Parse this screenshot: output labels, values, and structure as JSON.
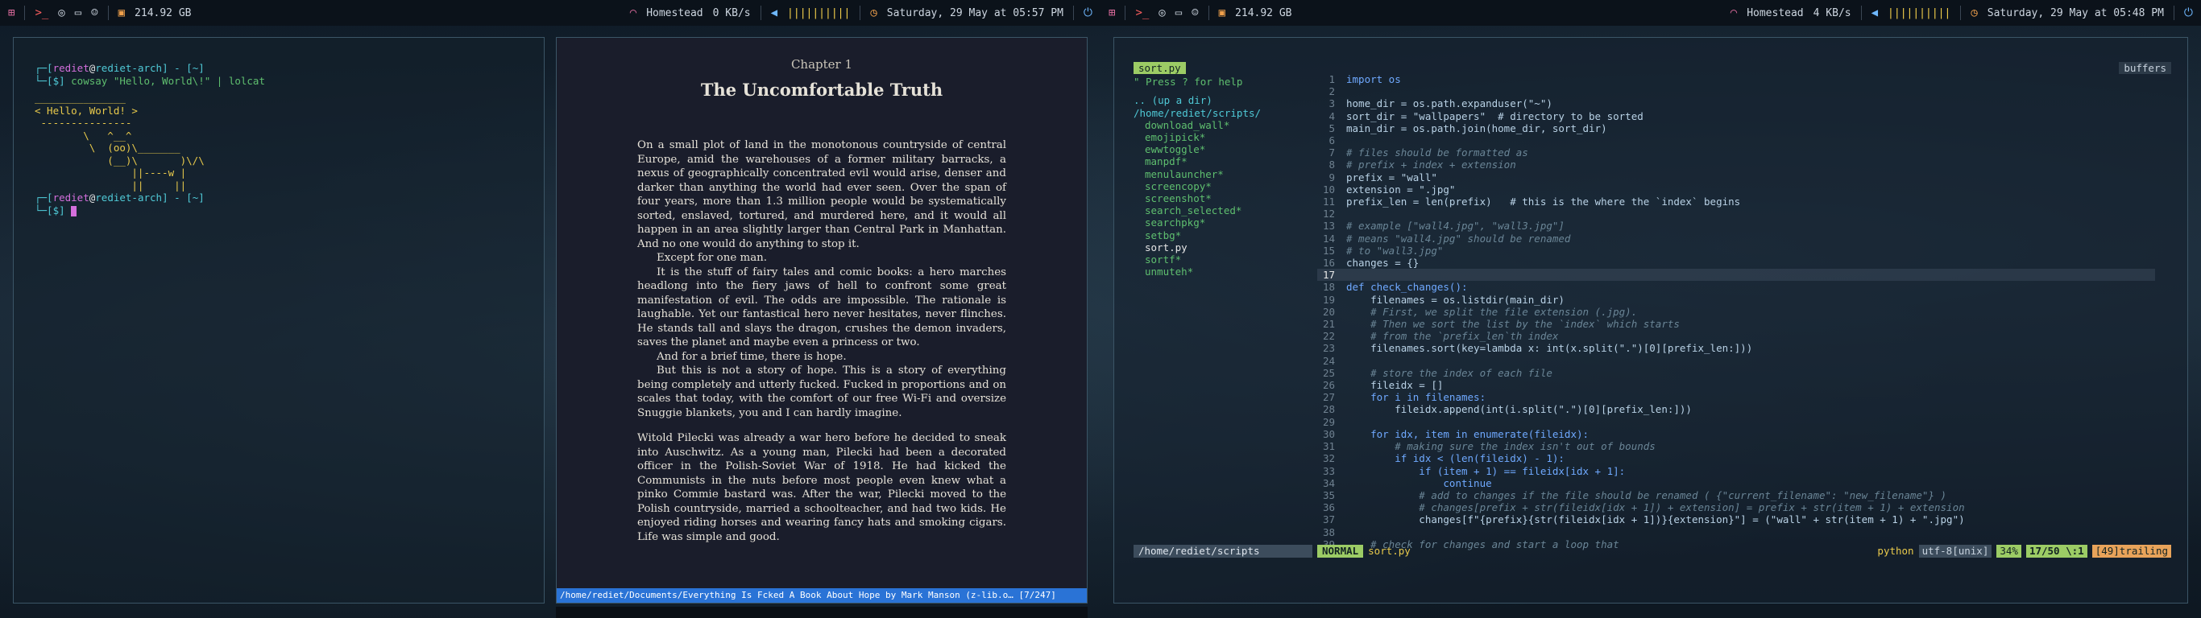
{
  "left_bar": {
    "storage": "214.92 GB",
    "network_name": "Homestead",
    "network_speed": "0 KB/s",
    "volume_bars": "||||||||||",
    "clock": "Saturday, 29 May at 05:57 PM"
  },
  "right_bar": {
    "storage": "214.92 GB",
    "network_name": "Homestead",
    "network_speed": "4 KB/s",
    "volume_bars": "||||||||||",
    "clock": "Saturday, 29 May at 05:48 PM"
  },
  "terminal": {
    "user": "rediet",
    "at": "@",
    "host": "rediet-arch",
    "path": "[~]",
    "command": "cowsay \"Hello, World\\!\" | lolcat",
    "cow_lines": [
      "_______________",
      "< Hello, World! >",
      " ---------------",
      "        \\   ^__^",
      "         \\  (oo)\\_______",
      "            (__)\\       )\\/\\",
      "                ||----w |",
      "                ||     ||"
    ]
  },
  "reader": {
    "chapter": "Chapter 1",
    "title": "The Uncomfortable Truth",
    "paragraphs": [
      "On a small plot of land in the monotonous countryside of central Europe, amid the warehouses of a former military barracks, a nexus of geographically concentrated evil would arise, denser and darker than anything the world had ever seen. Over the span of four years, more than 1.3 million people would be systematically sorted, enslaved, tortured, and murdered here, and it would all happen in an area slightly larger than Central Park in Manhattan. And no one would do anything to stop it.",
      "Except for one man.",
      "It is the stuff of fairy tales and comic books: a hero marches headlong into the fiery jaws of hell to confront some great manifestation of evil. The odds are impossible. The rationale is laughable. Yet our fantastical hero never hesitates, never flinches. He stands tall and slays the dragon, crushes the demon invaders, saves the planet and maybe even a princess or two.",
      "And for a brief time, there is hope.",
      "But this is not a story of hope. This is a story of everything being completely and utterly fucked. Fucked in proportions and on scales that today, with the comfort of our free Wi-Fi and oversize Snuggie blankets, you and I can hardly imagine.",
      "Witold Pilecki was already a war hero before he decided to sneak into Auschwitz. As a young man, Pilecki had been a decorated officer in the Polish-Soviet War of 1918. He had kicked the Communists in the nuts before most people even knew what a pinko Commie bastard was. After the war, Pilecki moved to the Polish countryside, married a schoolteacher, and had two kids. He enjoyed riding horses and wearing fancy hats and smoking cigars. Life was simple and good."
    ],
    "status": "/home/rediet/Documents/Everything Is Fcked A Book About Hope by Mark Manson (z-lib.o… [7/247]"
  },
  "vim": {
    "nerd_tab": "sort.py",
    "help": "\" Press ? for help",
    "buffers": "buffers",
    "up": ".. (up a dir)",
    "cwd": "/home/rediet/scripts/",
    "files": [
      "download_wall*",
      "emojipick*",
      "ewwtoggle*",
      "manpdf*",
      "menulauncher*",
      "screencopy*",
      "screenshot*",
      "search_selected*",
      "searchpkg*",
      "setbg*",
      "sort.py",
      "sortf*",
      "unmuteh*"
    ],
    "code": [
      [
        "1",
        "import os"
      ],
      [
        "2",
        ""
      ],
      [
        "3",
        "home_dir = os.path.expanduser(\"~\")"
      ],
      [
        "4",
        "sort_dir = \"wallpapers\"  # directory to be sorted"
      ],
      [
        "5",
        "main_dir = os.path.join(home_dir, sort_dir)"
      ],
      [
        "6",
        ""
      ],
      [
        "7",
        "# files should be formatted as"
      ],
      [
        "8",
        "# prefix + index + extension"
      ],
      [
        "9",
        "prefix = \"wall\""
      ],
      [
        "10",
        "extension = \".jpg\""
      ],
      [
        "11",
        "prefix_len = len(prefix)   # this is the where the `index` begins"
      ],
      [
        "12",
        ""
      ],
      [
        "13",
        "# example [\"wall4.jpg\", \"wall3.jpg\"]"
      ],
      [
        "14",
        "# means \"wall4.jpg\" should be renamed"
      ],
      [
        "15",
        "# to \"wall3.jpg\""
      ],
      [
        "16",
        "changes = {}"
      ],
      [
        "17",
        ""
      ],
      [
        "18",
        "def check_changes():"
      ],
      [
        "19",
        "    filenames = os.listdir(main_dir)"
      ],
      [
        "20",
        "    # First, we split the file extension (.jpg)."
      ],
      [
        "21",
        "    # Then we sort the list by the `index` which starts"
      ],
      [
        "22",
        "    # from the `prefix_len`th index"
      ],
      [
        "23",
        "    filenames.sort(key=lambda x: int(x.split(\".\")[0][prefix_len:]))"
      ],
      [
        "24",
        ""
      ],
      [
        "25",
        "    # store the index of each file"
      ],
      [
        "26",
        "    fileidx = []"
      ],
      [
        "27",
        "    for i in filenames:"
      ],
      [
        "28",
        "        fileidx.append(int(i.split(\".\")[0][prefix_len:]))"
      ],
      [
        "29",
        ""
      ],
      [
        "30",
        "    for idx, item in enumerate(fileidx):"
      ],
      [
        "31",
        "        # making sure the index isn't out of bounds"
      ],
      [
        "32",
        "        if idx < (len(fileidx) - 1):"
      ],
      [
        "33",
        "            if (item + 1) == fileidx[idx + 1]:"
      ],
      [
        "34",
        "                continue"
      ],
      [
        "35",
        "            # add to changes if the file should be renamed ( {\"current_filename\": \"new_filename\"} )"
      ],
      [
        "36",
        "            # changes[prefix + str(fileidx[idx + 1]) + extension] = prefix + str(item + 1) + extension"
      ],
      [
        "37",
        "            changes[f\"{prefix}{str(fileidx[idx + 1])}{extension}\"] = (\"wall\" + str(item + 1) + \".jpg\")"
      ],
      [
        "38",
        ""
      ],
      [
        "39",
        "    # check for changes and start a loop that"
      ]
    ],
    "status_left_path": "/home/rediet/scripts",
    "mode": "NORMAL",
    "file": "sort.py",
    "filetype": "python",
    "encoding": "utf-8[unix]",
    "percent": "34%",
    "position": "17/50 \\:1",
    "trailing": "[49]trailing"
  }
}
